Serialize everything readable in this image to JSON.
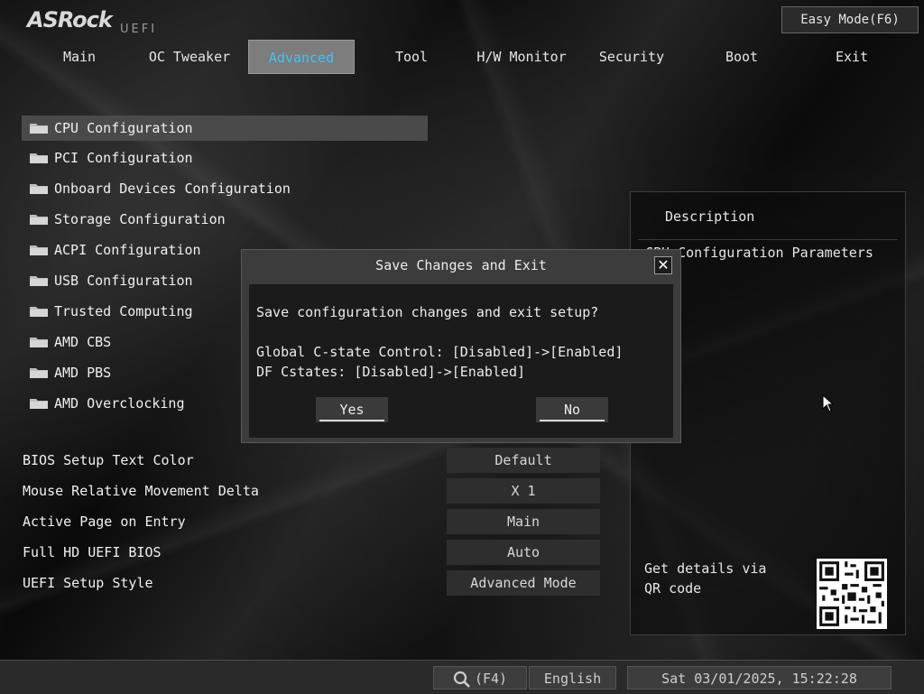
{
  "brand": {
    "logo": "ASRock",
    "subtitle": "UEFI"
  },
  "header": {
    "easy_mode": "Easy Mode(F6)"
  },
  "tabs": [
    {
      "label": "Main"
    },
    {
      "label": "OC Tweaker"
    },
    {
      "label": "Advanced",
      "active": true
    },
    {
      "label": "Tool"
    },
    {
      "label": "H/W Monitor"
    },
    {
      "label": "Security"
    },
    {
      "label": "Boot"
    },
    {
      "label": "Exit"
    }
  ],
  "menu": [
    {
      "label": "CPU Configuration",
      "selected": true
    },
    {
      "label": "PCI Configuration"
    },
    {
      "label": "Onboard Devices Configuration"
    },
    {
      "label": "Storage Configuration"
    },
    {
      "label": "ACPI Configuration"
    },
    {
      "label": "USB Configuration"
    },
    {
      "label": "Trusted Computing"
    },
    {
      "label": "AMD CBS"
    },
    {
      "label": "AMD PBS"
    },
    {
      "label": "AMD Overclocking"
    }
  ],
  "settings": [
    {
      "label": "BIOS Setup Text Color",
      "value": "Default"
    },
    {
      "label": "Mouse Relative Movement Delta",
      "value": "X 1"
    },
    {
      "label": "Active Page on Entry",
      "value": "Main"
    },
    {
      "label": "Full HD UEFI BIOS",
      "value": "Auto"
    },
    {
      "label": "UEFI Setup Style",
      "value": "Advanced Mode"
    }
  ],
  "description": {
    "title": "Description",
    "text": "CPU Configuration Parameters",
    "qr_text": "Get details via QR code"
  },
  "dialog": {
    "title": "Save Changes and Exit",
    "question": "Save configuration changes and exit setup?",
    "line1": "Global C-state Control: [Disabled]->[Enabled]",
    "line2": "DF Cstates: [Disabled]->[Enabled]",
    "yes": "Yes",
    "no": "No"
  },
  "bottom": {
    "search_key": "(F4)",
    "language": "English",
    "datetime": "Sat 03/01/2025, 15:22:28"
  },
  "colors": {
    "active_tab_text": "#3fc3f2",
    "active_tab_bg": "#7d7d7d"
  }
}
